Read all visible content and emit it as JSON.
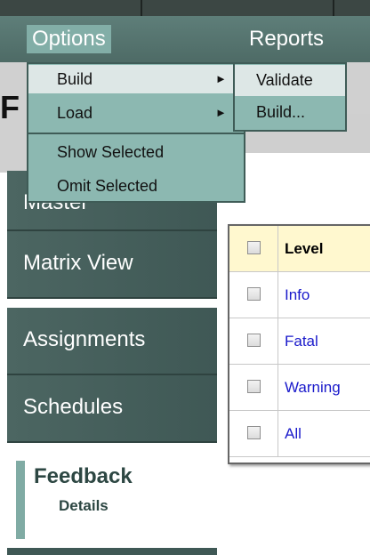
{
  "menubar": {
    "items": [
      {
        "label": "Options"
      },
      {
        "label": "Reports"
      }
    ]
  },
  "header": {
    "letter": "F"
  },
  "options_menu": {
    "items": [
      {
        "label": "Build",
        "has_submenu": true,
        "arrow": "►"
      },
      {
        "label": "Load",
        "has_submenu": true,
        "arrow": "►"
      },
      {
        "label": "Show Selected"
      },
      {
        "label": "Omit Selected"
      }
    ]
  },
  "build_submenu": {
    "items": [
      {
        "label": "Validate"
      },
      {
        "label": "Build..."
      }
    ]
  },
  "sidebar": {
    "items": [
      {
        "label": "Master"
      },
      {
        "label": "Matrix View"
      },
      {
        "label": "Assignments"
      },
      {
        "label": "Schedules"
      }
    ],
    "active": {
      "title": "Feedback",
      "subtitle": "Details"
    }
  },
  "level_table": {
    "header": "Level",
    "rows": [
      "Info",
      "Fatal",
      "Warning",
      "All"
    ]
  },
  "colors": {
    "nav_bg": "#4c6662",
    "menu_bg": "#8cb8b1",
    "menu_highlight": "#dde7e6",
    "accent": "#80aba4",
    "link": "#1a1acb"
  }
}
